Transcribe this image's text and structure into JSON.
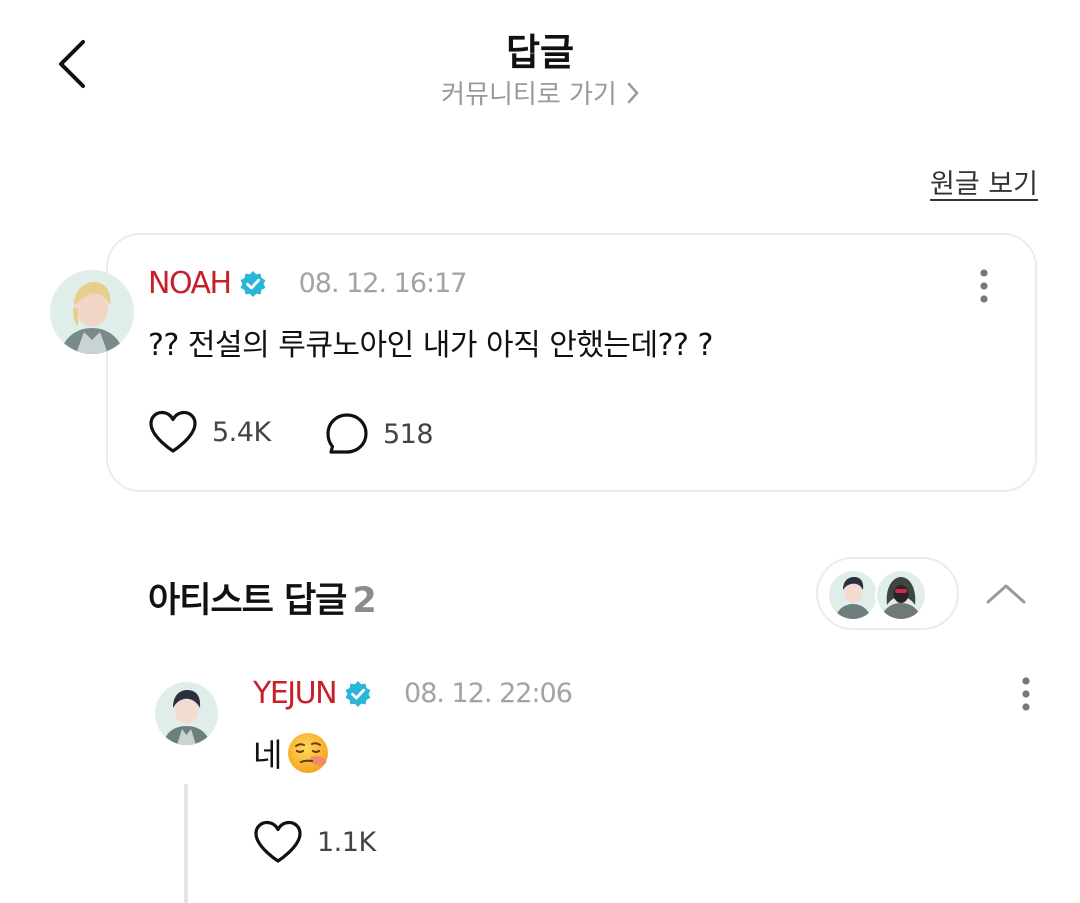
{
  "header": {
    "title": "답글",
    "community_link": "커뮤니티로 가기"
  },
  "view_original": "원글 보기",
  "post": {
    "author": "NOAH",
    "time": "08. 12. 16:17",
    "text": "?? 전설의 루큐노아인 내가 아직 안했는데?? ?",
    "likes": "5.4K",
    "replies": "518"
  },
  "section": {
    "title": "아티스트 답글",
    "count": "2"
  },
  "reply": {
    "author": "YEJUN",
    "time": "08. 12. 22:06",
    "text": "네",
    "likes": "1.1K"
  },
  "colors": {
    "author_name": "#c8202a",
    "verified_badge": "#2bb5d8",
    "secondary_text": "#a3a3a3"
  },
  "icons": {
    "back": "chevron-left-icon",
    "more": "more-vertical-icon",
    "like": "heart-outline-icon",
    "comment": "speech-bubble-icon",
    "collapse": "chevron-up-icon"
  }
}
